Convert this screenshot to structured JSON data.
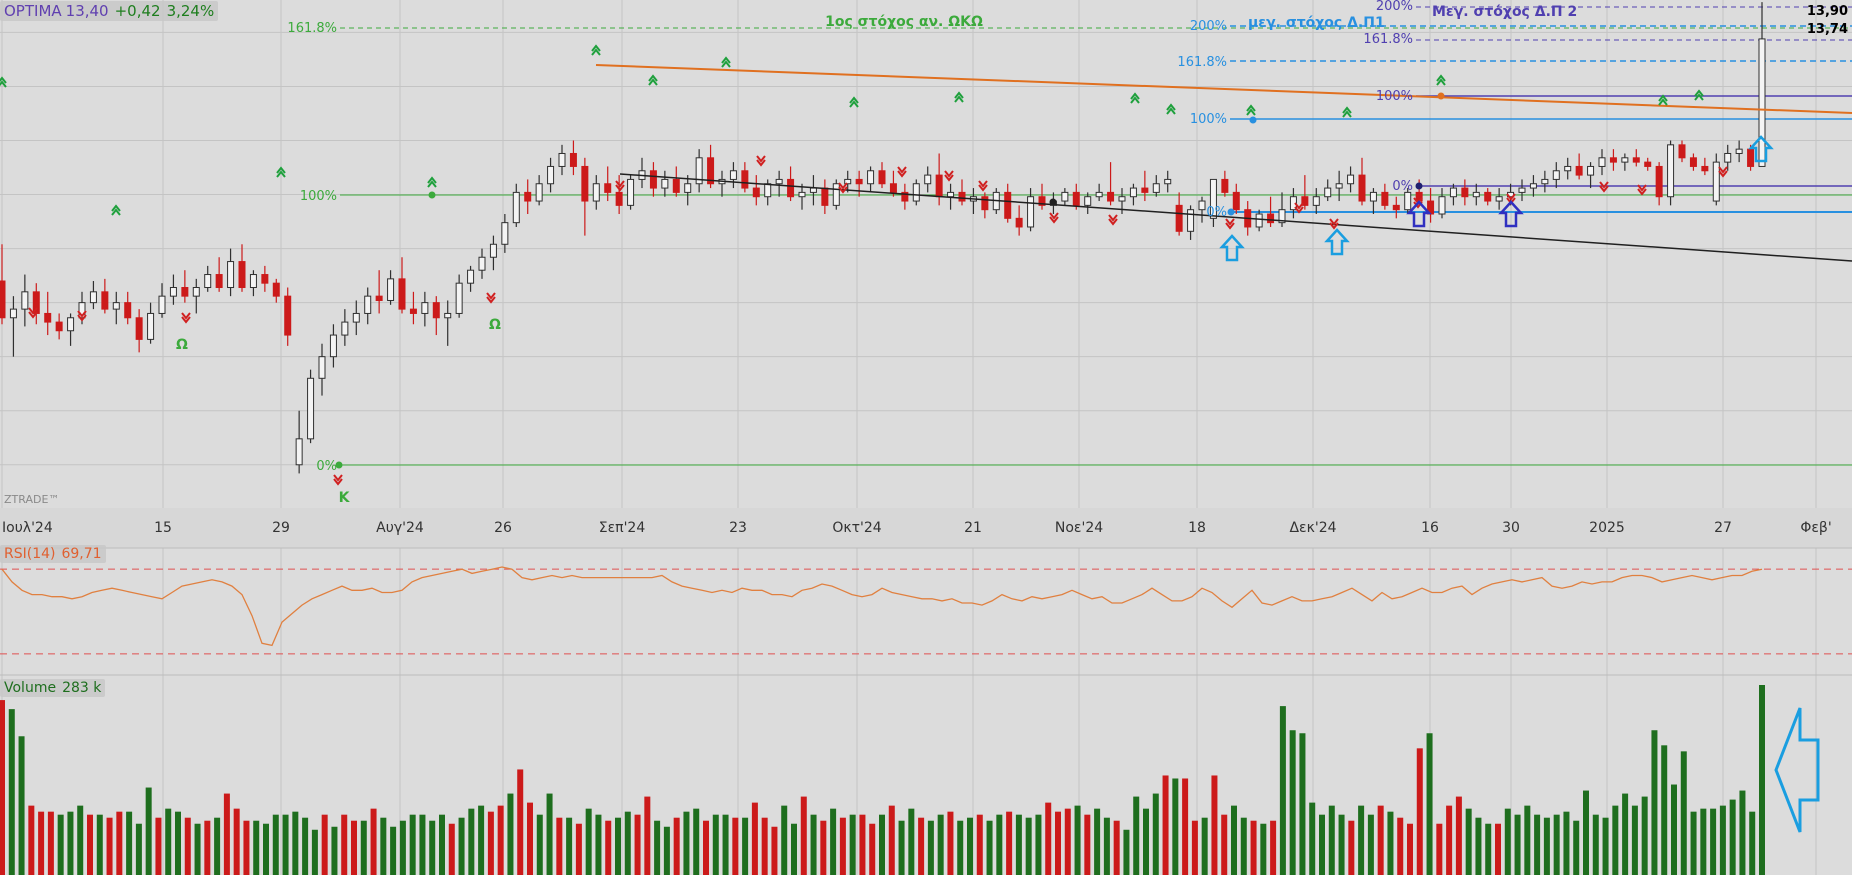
{
  "header": {
    "symbol": "OPTIMA",
    "last": "13,40",
    "change": "+0,42",
    "change_pct": "3,24%"
  },
  "rsi_header": {
    "name": "RSI(14)",
    "value": "69,71"
  },
  "volume_header": {
    "name": "Volume",
    "value": "283 k"
  },
  "watermark": "ZTRADE™",
  "colors": {
    "up": "#1e6e1e",
    "down": "#cc1a1a",
    "orange": "#e07020",
    "green_fib": "#3caa3c",
    "blue_fib": "#2890e0",
    "purple_fib": "#5040b0",
    "rsi": "#e08040",
    "grid": "#c4c4c4"
  },
  "annotations": {
    "g_161": "161.8%",
    "g_100": "100%",
    "g_0": "0%",
    "g_target": "1ος στόχος αν. ΩΚΩ",
    "b_200": "200%",
    "b_161": "161.8%",
    "b_100": "100%",
    "b_0": "0%",
    "b_target": "μεγ. στόχος Δ.Π1",
    "p_200": "200%",
    "p_161": "161.8%",
    "p_100": "100%",
    "p_0": "0%",
    "p_target": "Μεγ. στόχος Δ.Π 2",
    "omega1": "Ω",
    "omega2": "Ω",
    "kappa": "K",
    "price_r1": "13,90",
    "price_r2": "13,74"
  },
  "chart_data": [
    {
      "type": "candlestick",
      "x_labels": [
        "Ιουλ'24",
        "15",
        "29",
        "Αυγ'24",
        "26",
        "Σεπ'24",
        "23",
        "Οκτ'24",
        "21",
        "Νοε'24",
        "18",
        "Δεκ'24",
        "16",
        "30",
        "2025",
        "27",
        "Φεβ'"
      ],
      "y_range": [
        11.6,
        13.95
      ],
      "series": [
        [
          12.65,
          12.82,
          12.45,
          12.48
        ],
        [
          12.48,
          12.58,
          12.3,
          12.52
        ],
        [
          12.52,
          12.68,
          12.44,
          12.6
        ],
        [
          12.6,
          12.64,
          12.45,
          12.5
        ],
        [
          12.5,
          12.6,
          12.4,
          12.46
        ],
        [
          12.46,
          12.5,
          12.38,
          12.42
        ],
        [
          12.42,
          12.5,
          12.35,
          12.48
        ],
        [
          12.48,
          12.6,
          12.45,
          12.55
        ],
        [
          12.55,
          12.65,
          12.52,
          12.6
        ],
        [
          12.6,
          12.66,
          12.5,
          12.52
        ],
        [
          12.52,
          12.6,
          12.45,
          12.55
        ],
        [
          12.55,
          12.6,
          12.45,
          12.48
        ],
        [
          12.48,
          12.52,
          12.32,
          12.38
        ],
        [
          12.38,
          12.55,
          12.36,
          12.5
        ],
        [
          12.5,
          12.64,
          12.48,
          12.58
        ],
        [
          12.58,
          12.68,
          12.54,
          12.62
        ],
        [
          12.62,
          12.7,
          12.55,
          12.58
        ],
        [
          12.58,
          12.66,
          12.5,
          12.62
        ],
        [
          12.62,
          12.72,
          12.6,
          12.68
        ],
        [
          12.68,
          12.76,
          12.6,
          12.62
        ],
        [
          12.62,
          12.8,
          12.58,
          12.74
        ],
        [
          12.74,
          12.82,
          12.6,
          12.62
        ],
        [
          12.62,
          12.7,
          12.58,
          12.68
        ],
        [
          12.68,
          12.72,
          12.6,
          12.64
        ],
        [
          12.64,
          12.66,
          12.55,
          12.58
        ],
        [
          12.58,
          12.62,
          12.35,
          12.4
        ],
        [
          11.8,
          12.05,
          11.76,
          11.92
        ],
        [
          11.92,
          12.24,
          11.9,
          12.2
        ],
        [
          12.2,
          12.36,
          12.12,
          12.3
        ],
        [
          12.3,
          12.45,
          12.25,
          12.4
        ],
        [
          12.4,
          12.52,
          12.35,
          12.46
        ],
        [
          12.46,
          12.56,
          12.4,
          12.5
        ],
        [
          12.5,
          12.62,
          12.45,
          12.58
        ],
        [
          12.58,
          12.7,
          12.5,
          12.56
        ],
        [
          12.56,
          12.7,
          12.54,
          12.66
        ],
        [
          12.66,
          12.76,
          12.5,
          12.52
        ],
        [
          12.52,
          12.6,
          12.45,
          12.5
        ],
        [
          12.5,
          12.6,
          12.44,
          12.55
        ],
        [
          12.55,
          12.58,
          12.4,
          12.48
        ],
        [
          12.48,
          12.56,
          12.35,
          12.5
        ],
        [
          12.5,
          12.68,
          12.48,
          12.64
        ],
        [
          12.64,
          12.72,
          12.6,
          12.7
        ],
        [
          12.7,
          12.8,
          12.66,
          12.76
        ],
        [
          12.76,
          12.86,
          12.7,
          12.82
        ],
        [
          12.82,
          12.96,
          12.78,
          12.92
        ],
        [
          12.92,
          13.1,
          12.9,
          13.06
        ],
        [
          13.06,
          13.12,
          12.96,
          13.02
        ],
        [
          13.02,
          13.14,
          13.0,
          13.1
        ],
        [
          13.1,
          13.22,
          13.06,
          13.18
        ],
        [
          13.18,
          13.28,
          13.14,
          13.24
        ],
        [
          13.24,
          13.3,
          13.14,
          13.18
        ],
        [
          13.18,
          13.22,
          12.86,
          13.02
        ],
        [
          13.02,
          13.14,
          12.98,
          13.1
        ],
        [
          13.1,
          13.18,
          13.02,
          13.06
        ],
        [
          13.06,
          13.14,
          12.96,
          13.0
        ],
        [
          13.0,
          13.14,
          12.98,
          13.12
        ],
        [
          13.12,
          13.22,
          13.08,
          13.16
        ],
        [
          13.16,
          13.2,
          13.04,
          13.08
        ],
        [
          13.08,
          13.16,
          13.04,
          13.12
        ],
        [
          13.12,
          13.18,
          13.04,
          13.06
        ],
        [
          13.06,
          13.14,
          13.0,
          13.1
        ],
        [
          13.1,
          13.26,
          13.06,
          13.22
        ],
        [
          13.22,
          13.28,
          13.08,
          13.1
        ],
        [
          13.1,
          13.16,
          13.04,
          13.12
        ],
        [
          13.12,
          13.2,
          13.08,
          13.16
        ],
        [
          13.16,
          13.2,
          13.06,
          13.08
        ],
        [
          13.08,
          13.14,
          13.0,
          13.04
        ],
        [
          13.04,
          13.12,
          13.0,
          13.1
        ],
        [
          13.1,
          13.16,
          13.04,
          13.12
        ],
        [
          13.12,
          13.18,
          13.02,
          13.04
        ],
        [
          13.04,
          13.1,
          12.98,
          13.06
        ],
        [
          13.06,
          13.14,
          13.0,
          13.08
        ],
        [
          13.08,
          13.12,
          12.96,
          13.0
        ],
        [
          13.0,
          13.12,
          12.98,
          13.1
        ],
        [
          13.1,
          13.16,
          13.06,
          13.12
        ],
        [
          13.12,
          13.16,
          13.04,
          13.1
        ],
        [
          13.1,
          13.18,
          13.06,
          13.16
        ],
        [
          13.16,
          13.2,
          13.08,
          13.1
        ],
        [
          13.1,
          13.16,
          13.04,
          13.06
        ],
        [
          13.06,
          13.1,
          12.98,
          13.02
        ],
        [
          13.02,
          13.12,
          13.0,
          13.1
        ],
        [
          13.1,
          13.18,
          13.06,
          13.14
        ],
        [
          13.14,
          13.24,
          13.0,
          13.04
        ],
        [
          13.04,
          13.1,
          12.98,
          13.06
        ],
        [
          13.06,
          13.12,
          13.0,
          13.02
        ],
        [
          13.02,
          13.08,
          12.96,
          13.04
        ],
        [
          13.04,
          13.06,
          12.94,
          12.98
        ],
        [
          12.98,
          13.08,
          12.96,
          13.06
        ],
        [
          13.06,
          13.1,
          12.92,
          12.94
        ],
        [
          12.94,
          13.0,
          12.86,
          12.9
        ],
        [
          12.9,
          13.08,
          12.88,
          13.04
        ],
        [
          13.04,
          13.1,
          12.98,
          13.0
        ],
        [
          13.0,
          13.06,
          12.96,
          13.02
        ],
        [
          13.02,
          13.08,
          13.0,
          13.06
        ],
        [
          13.06,
          13.1,
          12.98,
          13.0
        ],
        [
          13.0,
          13.06,
          12.96,
          13.04
        ],
        [
          13.04,
          13.1,
          13.02,
          13.06
        ],
        [
          13.06,
          13.2,
          13.0,
          13.02
        ],
        [
          13.02,
          13.08,
          12.96,
          13.04
        ],
        [
          13.04,
          13.1,
          13.0,
          13.08
        ],
        [
          13.08,
          13.16,
          13.02,
          13.06
        ],
        [
          13.06,
          13.14,
          13.04,
          13.1
        ],
        [
          13.1,
          13.16,
          13.06,
          13.12
        ],
        [
          13.0,
          13.06,
          12.86,
          12.88
        ],
        [
          12.88,
          13.0,
          12.84,
          12.98
        ],
        [
          12.98,
          13.04,
          12.92,
          13.02
        ],
        [
          12.94,
          13.12,
          12.9,
          13.12
        ],
        [
          13.12,
          13.16,
          13.04,
          13.06
        ],
        [
          13.06,
          13.1,
          12.96,
          12.98
        ],
        [
          12.98,
          13.02,
          12.86,
          12.9
        ],
        [
          12.9,
          12.98,
          12.88,
          12.96
        ],
        [
          12.96,
          13.04,
          12.9,
          12.92
        ],
        [
          12.92,
          13.06,
          12.9,
          12.98
        ],
        [
          12.98,
          13.08,
          12.94,
          13.04
        ],
        [
          13.04,
          13.14,
          12.98,
          13.0
        ],
        [
          13.0,
          13.08,
          12.96,
          13.04
        ],
        [
          13.04,
          13.12,
          13.02,
          13.08
        ],
        [
          13.08,
          13.16,
          13.02,
          13.1
        ],
        [
          13.1,
          13.18,
          13.06,
          13.14
        ],
        [
          13.14,
          13.22,
          13.0,
          13.02
        ],
        [
          13.02,
          13.08,
          12.96,
          13.06
        ],
        [
          13.06,
          13.1,
          12.98,
          13.0
        ],
        [
          13.0,
          13.04,
          12.94,
          12.98
        ],
        [
          12.98,
          13.08,
          12.96,
          13.06
        ],
        [
          13.06,
          13.12,
          13.0,
          13.02
        ],
        [
          13.02,
          13.08,
          12.92,
          12.96
        ],
        [
          12.96,
          13.08,
          12.94,
          13.04
        ],
        [
          13.04,
          13.1,
          13.0,
          13.08
        ],
        [
          13.08,
          13.12,
          13.0,
          13.04
        ],
        [
          13.04,
          13.1,
          13.0,
          13.06
        ],
        [
          13.06,
          13.08,
          13.0,
          13.02
        ],
        [
          13.02,
          13.08,
          12.98,
          13.04
        ],
        [
          13.04,
          13.1,
          13.0,
          13.06
        ],
        [
          13.06,
          13.12,
          13.02,
          13.08
        ],
        [
          13.08,
          13.14,
          13.04,
          13.1
        ],
        [
          13.1,
          13.16,
          13.06,
          13.12
        ],
        [
          13.12,
          13.2,
          13.08,
          13.16
        ],
        [
          13.16,
          13.22,
          13.12,
          13.18
        ],
        [
          13.18,
          13.24,
          13.12,
          13.14
        ],
        [
          13.14,
          13.2,
          13.08,
          13.18
        ],
        [
          13.18,
          13.26,
          13.14,
          13.22
        ],
        [
          13.22,
          13.26,
          13.16,
          13.2
        ],
        [
          13.2,
          13.24,
          13.16,
          13.22
        ],
        [
          13.22,
          13.26,
          13.18,
          13.2
        ],
        [
          13.2,
          13.22,
          13.16,
          13.18
        ],
        [
          13.18,
          13.2,
          13.0,
          13.04
        ],
        [
          13.04,
          13.3,
          13.0,
          13.28
        ],
        [
          13.28,
          13.3,
          13.2,
          13.22
        ],
        [
          13.22,
          13.24,
          13.16,
          13.18
        ],
        [
          13.18,
          13.22,
          13.14,
          13.16
        ],
        [
          13.02,
          13.24,
          13.0,
          13.2
        ],
        [
          13.2,
          13.28,
          13.16,
          13.24
        ],
        [
          13.24,
          13.3,
          13.2,
          13.26
        ],
        [
          13.26,
          13.28,
          13.16,
          13.18
        ],
        [
          13.18,
          13.94,
          13.18,
          13.77
        ]
      ]
    },
    {
      "type": "line",
      "name": "RSI(14)",
      "y_range": [
        20,
        80
      ],
      "overbought": 70,
      "oversold": 30,
      "values": [
        70,
        64,
        60,
        58,
        58,
        57,
        57,
        56,
        57,
        59,
        60,
        61,
        60,
        59,
        58,
        57,
        56,
        59,
        62,
        63,
        64,
        65,
        64,
        62,
        58,
        48,
        35,
        34,
        45,
        49,
        53,
        56,
        58,
        60,
        62,
        60,
        60,
        61,
        59,
        59,
        60,
        64,
        66,
        67,
        68,
        69,
        70,
        68,
        69,
        70,
        71,
        70,
        66,
        65,
        66,
        67,
        66,
        67,
        66,
        66,
        66,
        66,
        66,
        66,
        66,
        66,
        67,
        64,
        62,
        61,
        60,
        59,
        60,
        59,
        61,
        60,
        60,
        58,
        58,
        57,
        60,
        61,
        63,
        62,
        60,
        58,
        57,
        58,
        61,
        59,
        58,
        57,
        56,
        56,
        55,
        56,
        54,
        54,
        53,
        55,
        58,
        56,
        55,
        57,
        56,
        57,
        58,
        60,
        58,
        56,
        57,
        54,
        54,
        56,
        58,
        61,
        58,
        55,
        55,
        57,
        61,
        59,
        55,
        52,
        56,
        60,
        54,
        53,
        55,
        57,
        55,
        55,
        56,
        57,
        59,
        61,
        58,
        55,
        59,
        56,
        57,
        59,
        61,
        59,
        59,
        61,
        62,
        58,
        61,
        63,
        64,
        65,
        64,
        65,
        66,
        62,
        61,
        62,
        64,
        63,
        64,
        64,
        66,
        67,
        67,
        66,
        64,
        65,
        66,
        67,
        66,
        65,
        66,
        67,
        67,
        69,
        70
      ]
    },
    {
      "type": "bar",
      "name": "Volume",
      "unit": "k",
      "y_range": [
        0,
        630
      ],
      "values": [
        580,
        550,
        460,
        230,
        210,
        210,
        200,
        210,
        230,
        200,
        200,
        190,
        210,
        210,
        170,
        290,
        190,
        220,
        210,
        190,
        170,
        180,
        190,
        270,
        220,
        180,
        180,
        170,
        200,
        200,
        210,
        190,
        150,
        200,
        160,
        200,
        180,
        180,
        220,
        190,
        160,
        180,
        200,
        200,
        180,
        200,
        170,
        190,
        220,
        230,
        210,
        230,
        270,
        350,
        240,
        200,
        270,
        190,
        190,
        170,
        220,
        200,
        180,
        190,
        210,
        200,
        260,
        180,
        160,
        190,
        210,
        220,
        180,
        200,
        200,
        190,
        190,
        240,
        190,
        160,
        230,
        170,
        260,
        200,
        180,
        220,
        190,
        200,
        200,
        170,
        200,
        230,
        180,
        220,
        190,
        180,
        200,
        210,
        180,
        190,
        200,
        180,
        200,
        210,
        200,
        190,
        200,
        240,
        210,
        220,
        230,
        200,
        220,
        190,
        180,
        150,
        260,
        220,
        270,
        330,
        320,
        320,
        180,
        190,
        330,
        200,
        230,
        190,
        180,
        170,
        180,
        560,
        480,
        470,
        240,
        200,
        230,
        200,
        180,
        230,
        200,
        230,
        210,
        190,
        170,
        420,
        470,
        170,
        230,
        260,
        220,
        190,
        170,
        170,
        220,
        200,
        230,
        200,
        190,
        200,
        210,
        180,
        280,
        200,
        190,
        230,
        270,
        230,
        260,
        480,
        430,
        300,
        410,
        210,
        220,
        220,
        230,
        250,
        280,
        210,
        630
      ]
    }
  ]
}
